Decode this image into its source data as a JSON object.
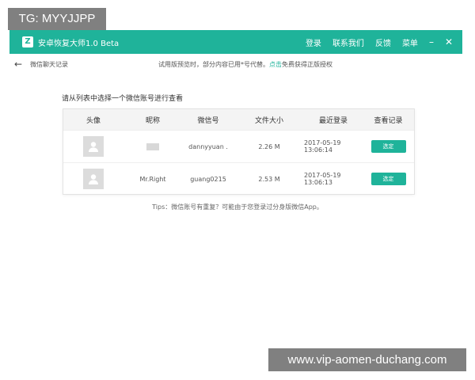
{
  "watermark_top": "TG: MYYJJPP",
  "watermark_bottom": "www.vip-aomen-duchang.com",
  "window": {
    "logo_letter": "Z",
    "title": "安卓恢复大师1.0 Beta",
    "menu": [
      "登录",
      "联系我们",
      "反馈",
      "菜单"
    ],
    "minimize": "–",
    "close": "✕"
  },
  "subbar": {
    "back_icon": "arrow-left-icon",
    "title": "微信聊天记录",
    "notice_prefix": "试用版预览时，部分内容已用*号代替。",
    "notice_link": "点击",
    "notice_suffix": "免费获得正版授权"
  },
  "instruction": "请从列表中选择一个微信账号进行查看",
  "table": {
    "headers": [
      "头像",
      "昵称",
      "微信号",
      "文件大小",
      "最近登录",
      "查看记录"
    ],
    "rows": [
      {
        "nickname": "",
        "wechat_id": "dannyyuan .",
        "size": "2.26 M",
        "last_login": "2017-05-19 13:06:14",
        "action": "选定"
      },
      {
        "nickname": "Mr.Right",
        "wechat_id": "guang0215",
        "size": "2.53 M",
        "last_login": "2017-05-19 13:06:13",
        "action": "选定"
      }
    ]
  },
  "tips": "Tips：微信账号有重复？可能由于您登录过分身版微信App。",
  "colors": {
    "accent": "#1fb39a"
  }
}
